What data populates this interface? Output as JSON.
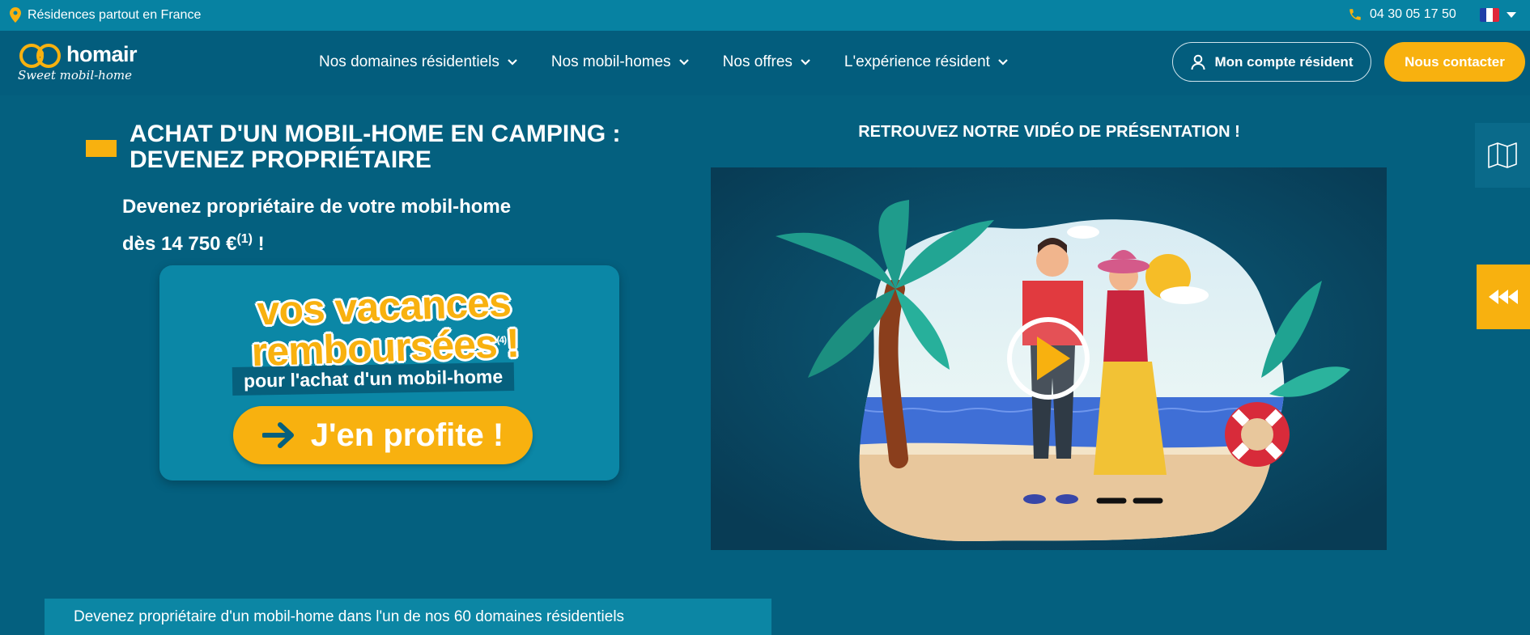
{
  "topbar": {
    "location_text": "Résidences partout en France",
    "phone": "04 30 05 17 50"
  },
  "header": {
    "brand": "homair",
    "tagline": "Sweet mobil-home",
    "nav": [
      {
        "label": "Nos domaines résidentiels"
      },
      {
        "label": "Nos mobil-homes"
      },
      {
        "label": "Nos offres"
      },
      {
        "label": "L'expérience résident"
      }
    ],
    "account_button": "Mon compte résident",
    "contact_button": "Nous contacter"
  },
  "hero": {
    "title_line1": "ACHAT D'UN MOBIL-HOME EN CAMPING :",
    "title_line2": "DEVENEZ PROPRIÉTAIRE",
    "subtitle_line1": "Devenez propriétaire de votre mobil-home",
    "subtitle_line2_prefix": "dès 14 750 €",
    "subtitle_sup": "(1)",
    "subtitle_suffix": " !",
    "promo": {
      "headline_line1": "vos vacances",
      "headline_line2": "remboursées",
      "headline_sup": "(4)",
      "headline_bang": "!",
      "subline": "pour l'achat d'un mobil-home",
      "cta": "J'en profite !"
    }
  },
  "video": {
    "heading": "RETROUVEZ NOTRE VIDÉO DE PRÉSENTATION !"
  },
  "bottom_strip": {
    "text": "Devenez propriétaire d'un mobil-home dans l'un de nos 60 domaines résidentiels"
  },
  "colors": {
    "background": "#04607f",
    "topbar": "#0782a2",
    "accent": "#f8b10f",
    "promo_card": "#0b87a6"
  },
  "icons": [
    "location-pin-icon",
    "phone-icon",
    "france-flag-icon",
    "chevron-down-icon",
    "user-icon",
    "arrow-right-icon",
    "play-icon",
    "map-icon",
    "rewind-icon"
  ]
}
